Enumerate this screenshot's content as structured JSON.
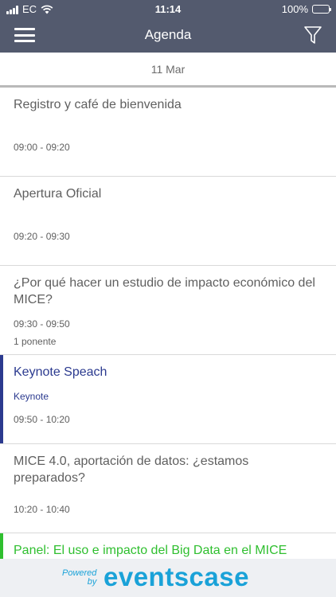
{
  "status_bar": {
    "carrier": "EC",
    "time": "11:14",
    "battery": "100%"
  },
  "header": {
    "title": "Agenda",
    "menu_icon": "hamburger-menu-icon",
    "filter_icon": "filter-funnel-icon"
  },
  "date": "11 Mar",
  "colors": {
    "header_bg": "#535a6e",
    "keynote_accent": "#2b3a8f",
    "panel_accent": "#2fbf2f",
    "brand": "#1aa2d8"
  },
  "sessions": [
    {
      "title": "Registro y café de bienvenida",
      "time": "09:00 - 09:20"
    },
    {
      "title": "Apertura Oficial",
      "time": "09:20 - 09:30"
    },
    {
      "title": "¿Por qué hacer un estudio de impacto económico del MICE?",
      "time": "09:30 - 09:50",
      "speakers": "1 ponente"
    },
    {
      "title": "Keynote Speach",
      "track": "Keynote",
      "time": "09:50 - 10:20"
    },
    {
      "title": "MICE 4.0, aportación de datos: ¿estamos preparados?",
      "time": "10:20 - 10:40"
    },
    {
      "title": "Panel: El uso e impacto del Big Data en el MICE"
    }
  ],
  "footer": {
    "powered_line1": "Powered",
    "powered_line2": "by",
    "brand": "eventscase"
  }
}
